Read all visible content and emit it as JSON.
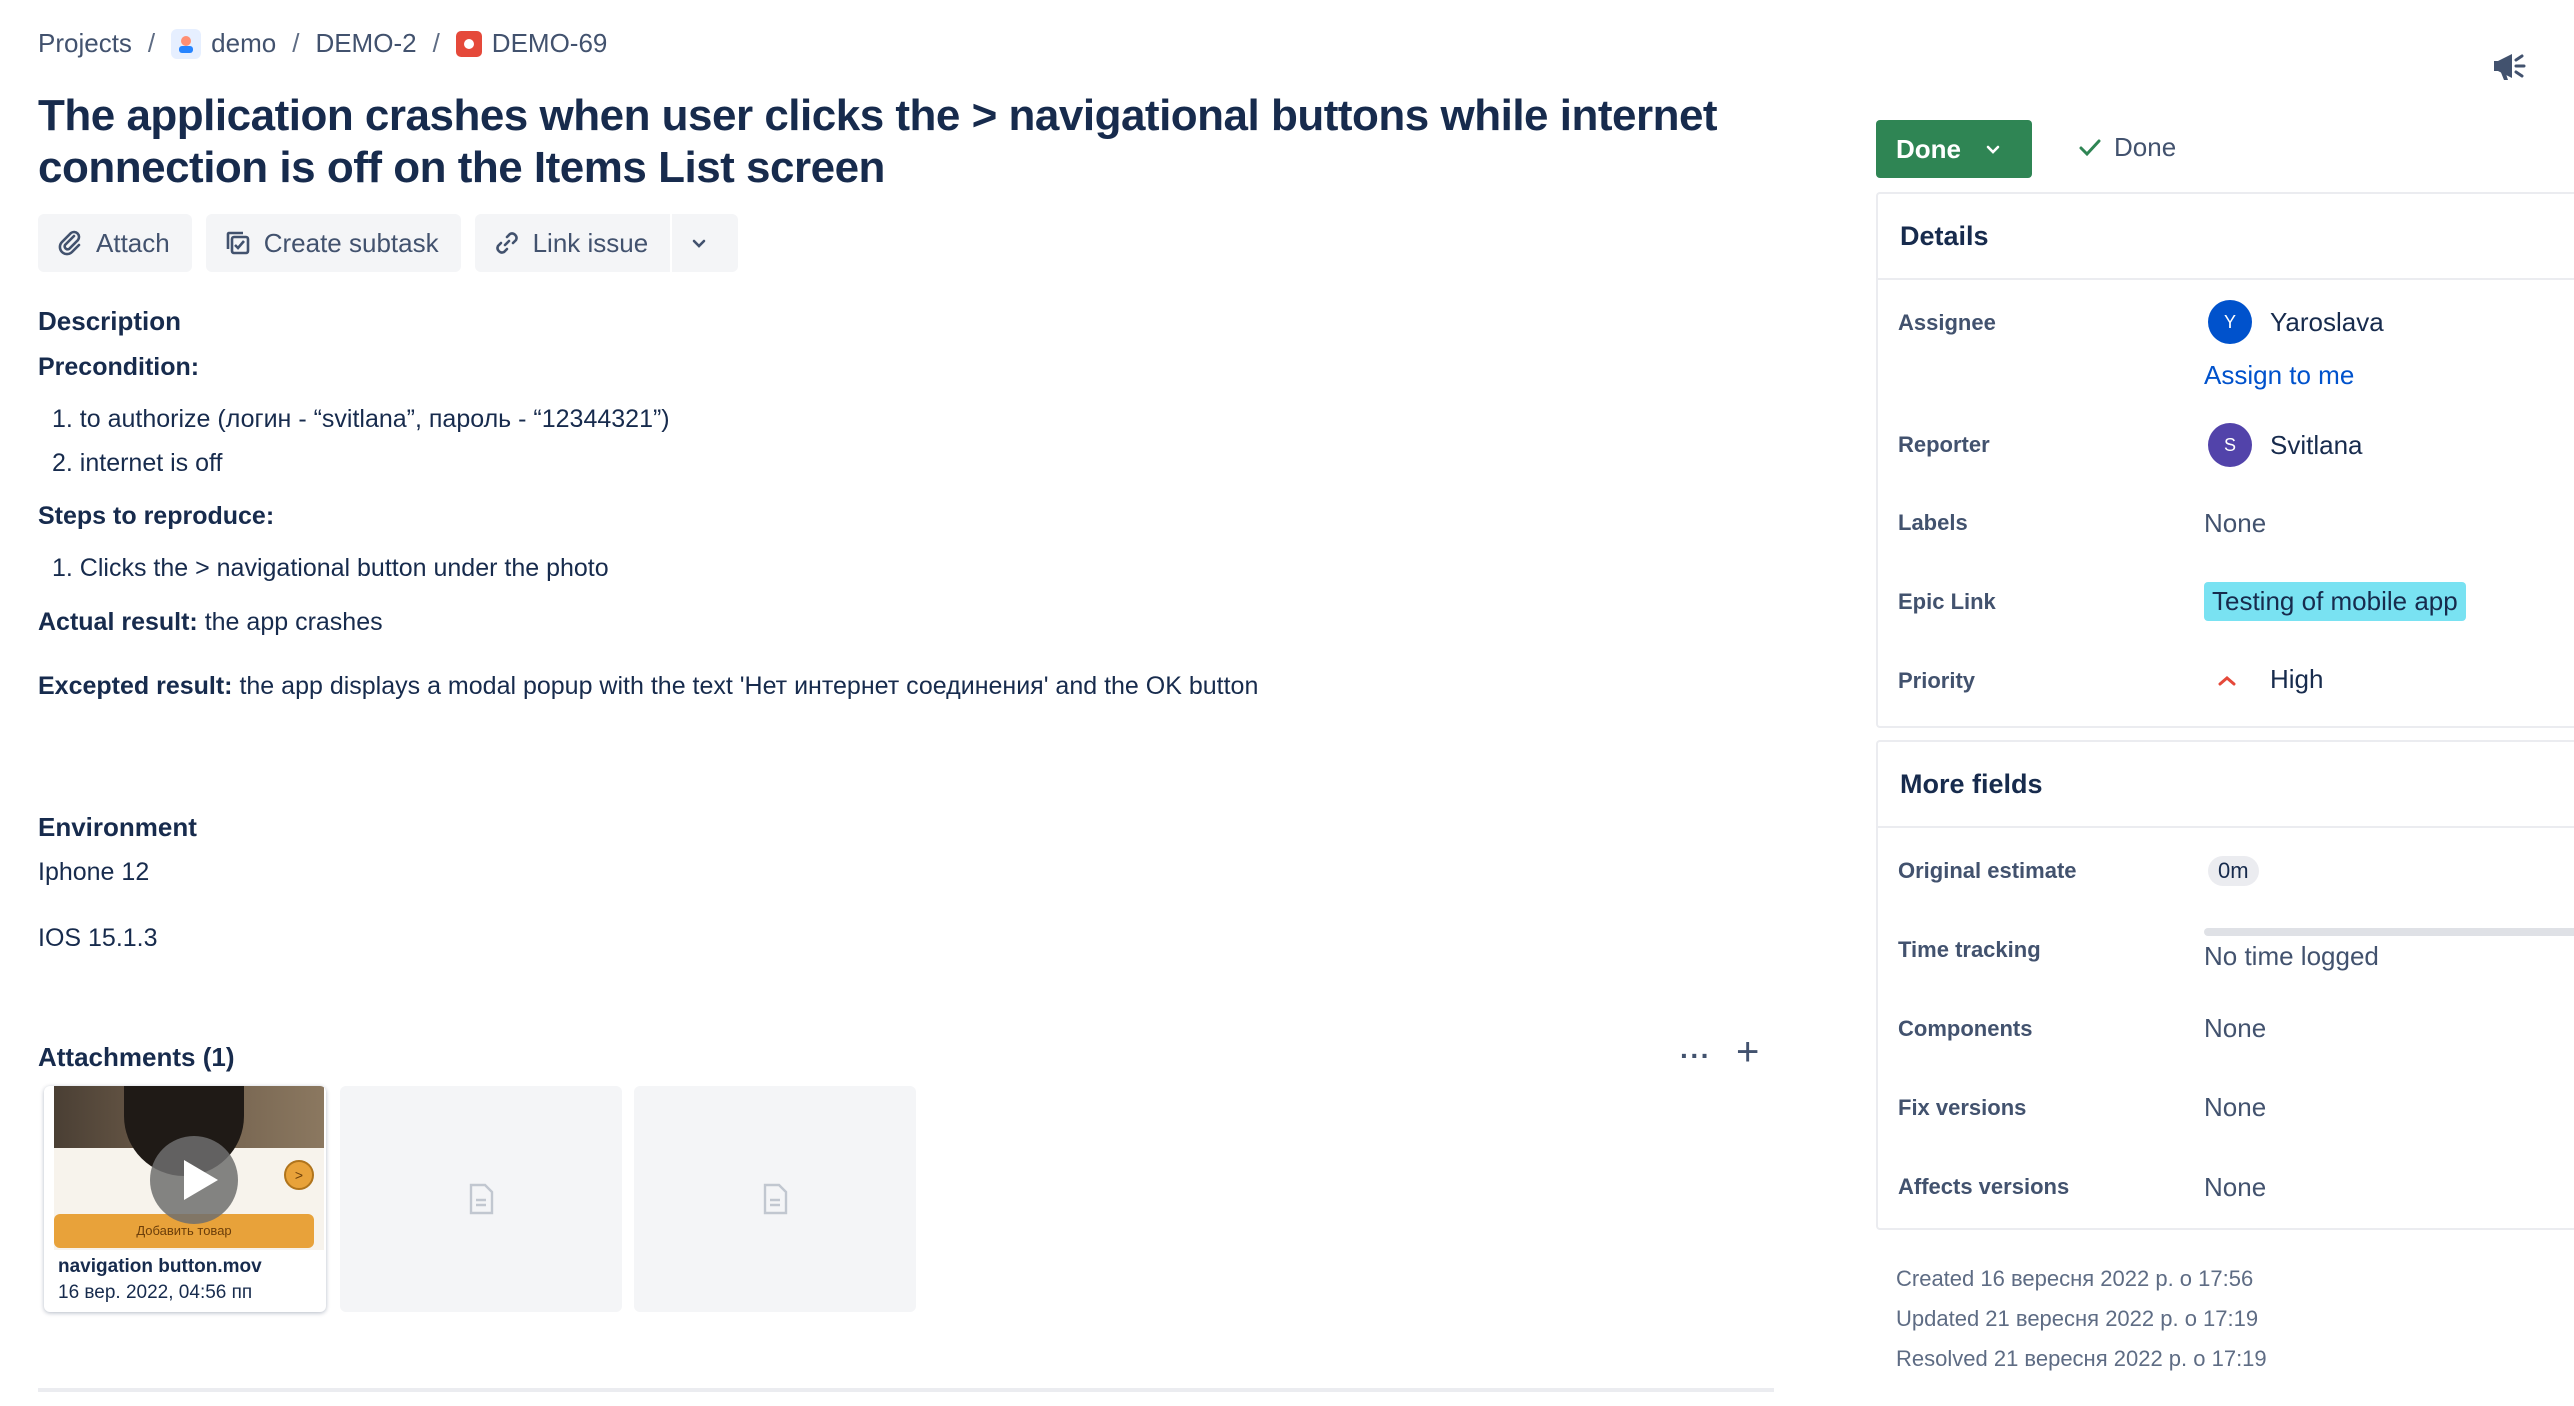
{
  "breadcrumb": {
    "projects": "Projects",
    "project": "demo",
    "epic": "DEMO-2",
    "issue": "DEMO-69",
    "separator": "/"
  },
  "issue": {
    "title": "The application crashes when user clicks the > navigational buttons while internet connection is off on the Items List screen"
  },
  "toolbar": {
    "attach": "Attach",
    "create_subtask": "Create subtask",
    "link_issue": "Link issue"
  },
  "description": {
    "heading": "Description",
    "precondition_label": "Precondition:",
    "preconditions": [
      "1. to authorize (логин - “svitlana”, пароль - “12344321”)",
      "2. internet is off"
    ],
    "steps_label": "Steps to reproduce:",
    "steps": [
      "1. Clicks the > navigational button under the photo"
    ],
    "actual_label": "Actual result:",
    "actual_text": " the app crashes",
    "expected_label": "Excepted result:",
    "expected_text": " the app displays a modal popup with the text 'Нет интернет соединения' and the OK button"
  },
  "environment": {
    "heading": "Environment",
    "line1": "Iphone 12",
    "line2": "IOS 15.1.3"
  },
  "attachments": {
    "heading": "Attachments (1)",
    "more": "···",
    "add": "+",
    "items": [
      {
        "name": "navigation button.mov",
        "date": "16 вер. 2022, 04:56 пп",
        "thumb_button": "Добавить товар",
        "thumb_arrow": ">"
      }
    ]
  },
  "status": {
    "button": "Done",
    "resolution": "Done",
    "color": "#2f8554"
  },
  "details": {
    "heading": "Details",
    "assignee_label": "Assignee",
    "assignee": "Yaroslava",
    "assignee_initial": "Y",
    "assign_to_me": "Assign to me",
    "reporter_label": "Reporter",
    "reporter": "Svitlana",
    "reporter_initial": "S",
    "labels_label": "Labels",
    "labels": "None",
    "epic_label": "Epic Link",
    "epic": "Testing of mobile app",
    "priority_label": "Priority",
    "priority": "High"
  },
  "more_fields": {
    "heading": "More fields",
    "original_estimate_label": "Original estimate",
    "original_estimate": "0m",
    "time_tracking_label": "Time tracking",
    "time_tracking": "No time logged",
    "components_label": "Components",
    "components": "None",
    "fix_versions_label": "Fix versions",
    "fix_versions": "None",
    "affects_versions_label": "Affects versions",
    "affects_versions": "None"
  },
  "meta": {
    "created": "Created 16 вересня 2022 р. о 17:56",
    "updated": "Updated 21 вересня 2022 р. о 17:19",
    "resolved": "Resolved 21 вересня 2022 р. о 17:19"
  },
  "colors": {
    "link": "#0052cc",
    "epic": "#79e2f2",
    "priority_high": "#e5493a",
    "assignee_avatar": "#0052cc",
    "reporter_avatar": "#5243aa"
  },
  "icons": [
    "project-avatar-icon",
    "bug-icon",
    "feedback-megaphone-icon",
    "paperclip-icon",
    "subtask-icon",
    "link-icon",
    "chevron-down-icon",
    "check-icon",
    "priority-high-icon",
    "play-icon",
    "file-icon"
  ]
}
